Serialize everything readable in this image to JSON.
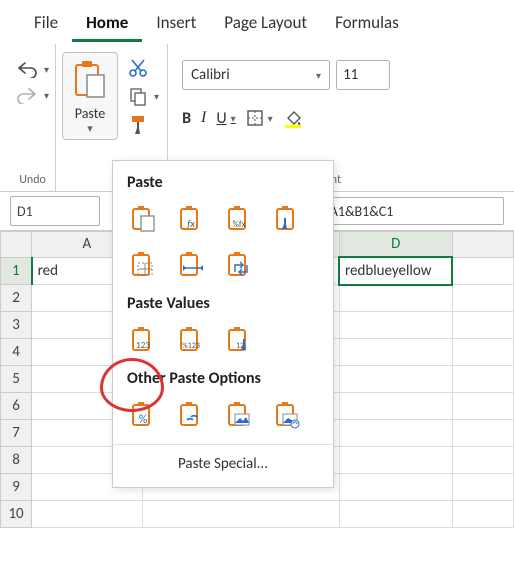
{
  "ribbon": {
    "tabs": [
      "File",
      "Home",
      "Insert",
      "Page Layout",
      "Formulas"
    ],
    "active_tab": 1,
    "undo_group_label": "Undo",
    "paste_label": "Paste",
    "font": {
      "name": "Calibri",
      "size": "11",
      "bold_label": "B",
      "italic_label": "I",
      "underline_label": "U",
      "group_label": "Font"
    }
  },
  "name_box": "D1",
  "formula": "=A1&B1&C1",
  "sheet": {
    "columns": [
      "A",
      "D"
    ],
    "rows": [
      "1",
      "2",
      "3",
      "4",
      "5",
      "6",
      "7",
      "8",
      "9",
      "10"
    ],
    "cells": {
      "A1": "red",
      "D1": "redblueyellow"
    },
    "selected": "D1"
  },
  "paste_menu": {
    "section1": "Paste",
    "section2": "Paste Values",
    "section3": "Other Paste Options",
    "special": "Paste Special...",
    "icons": {
      "paste_all": "paste-all",
      "paste_formulas": "paste-formulas",
      "paste_fx_number": "paste-formulas-number-formatting",
      "paste_source": "paste-keep-source-formatting",
      "paste_borders": "paste-no-borders",
      "paste_colwidth": "paste-keep-source-column-widths",
      "paste_transpose": "paste-transpose",
      "paste_values": "paste-values",
      "paste_values_number": "paste-values-number-formatting",
      "paste_values_source": "paste-values-source-formatting",
      "paste_formatting": "paste-formatting",
      "paste_link": "paste-link",
      "paste_picture": "paste-picture",
      "paste_linked_picture": "paste-linked-picture"
    }
  }
}
